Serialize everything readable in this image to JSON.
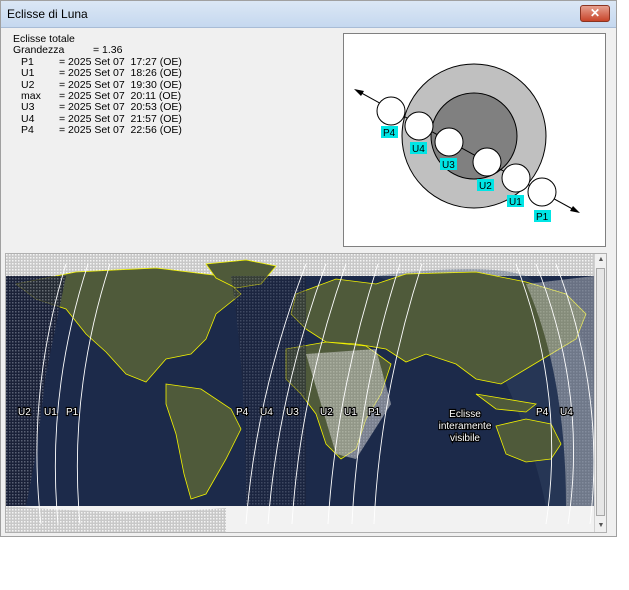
{
  "window": {
    "title": "Eclisse di Luna",
    "close_label": "✕"
  },
  "info": {
    "type": "Eclisse totale",
    "magnitude_label": "Grandezza",
    "magnitude_value": "= 1.36",
    "contacts": [
      {
        "name": "P1",
        "value": "= 2025 Set 07  17:27 (OE)"
      },
      {
        "name": "U1",
        "value": "= 2025 Set 07  18:26 (OE)"
      },
      {
        "name": "U2",
        "value": "= 2025 Set 07  19:30 (OE)"
      },
      {
        "name": "max",
        "value": "= 2025 Set 07  20:11 (OE)"
      },
      {
        "name": "U3",
        "value": "= 2025 Set 07  20:53 (OE)"
      },
      {
        "name": "U4",
        "value": "= 2025 Set 07  21:57 (OE)"
      },
      {
        "name": "P4",
        "value": "= 2025 Set 07  22:56 (OE)"
      }
    ]
  },
  "diagram": {
    "labels": [
      "P4",
      "U4",
      "U3",
      "U2",
      "U1",
      "P1"
    ],
    "colors": {
      "penumbra": "#c0c0c0",
      "umbra": "#808080",
      "moon": "#ffffff",
      "label_bg": "#00e5e5"
    }
  },
  "map": {
    "left_labels": [
      "U2",
      "U1",
      "P1"
    ],
    "mid_labels": [
      "P4",
      "U4",
      "U3"
    ],
    "mid2_labels": [
      "U2",
      "U1",
      "P1"
    ],
    "right_labels": [
      "P4",
      "U4"
    ],
    "visible_note": [
      "Eclisse",
      "interamente",
      "visibile"
    ],
    "colors": {
      "ocean": "#1c2a4a",
      "land": "#4f5a3a",
      "border": "#f2f200",
      "curves": "#ffffff"
    }
  }
}
